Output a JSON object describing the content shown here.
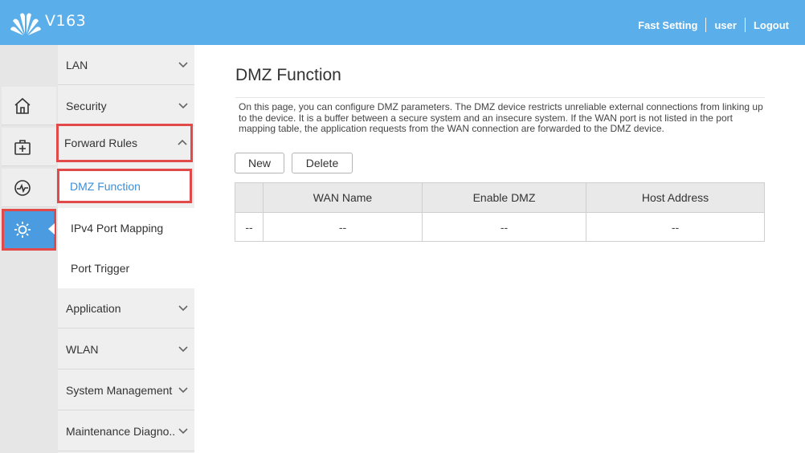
{
  "header": {
    "brand": "V163",
    "links": [
      "Fast Setting",
      "user",
      "Logout"
    ],
    "color": "#5aaee9"
  },
  "rail": {
    "icons": [
      "home-icon",
      "medkit-icon",
      "pulse-icon",
      "gear-icon"
    ],
    "active": "gear-icon"
  },
  "menu": {
    "items": {
      "lan": "LAN",
      "security": "Security",
      "forward_rules": "Forward Rules",
      "application": "Application",
      "wlan": "WLAN",
      "system_management": "System Management",
      "maintenance": "Maintenance Diagno.."
    },
    "sub_items": {
      "dmz": "DMZ Function",
      "ipv4": "IPv4 Port Mapping",
      "port_trigger": "Port Trigger"
    }
  },
  "main": {
    "title": "DMZ Function",
    "description": "On this page, you can configure DMZ parameters. The DMZ device restricts unreliable external connections from linking up to the device. It is a buffer between a secure system and an insecure system. If the WAN port is not listed in the port mapping table, the application requests from the WAN connection are forwarded to the DMZ device.",
    "buttons": {
      "new": "New",
      "delete": "Delete"
    },
    "table": {
      "headers": [
        "",
        "WAN Name",
        "Enable DMZ",
        "Host Address"
      ],
      "row": [
        "--",
        "--",
        "--",
        "--"
      ]
    }
  },
  "colors": {
    "accent": "#4a9be0",
    "highlight_border": "#e24a4a",
    "active_text": "#3a8fd9"
  }
}
